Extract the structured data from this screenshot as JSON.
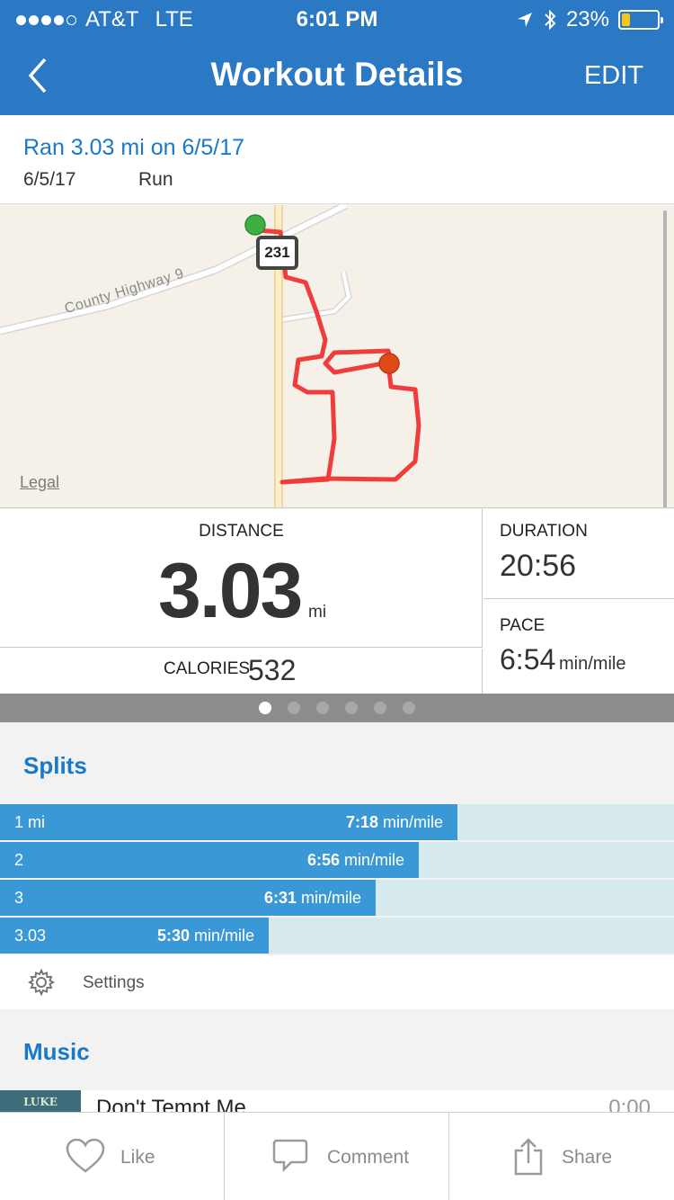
{
  "status": {
    "carrier": "AT&T",
    "network": "LTE",
    "time": "6:01 PM",
    "battery": "23%",
    "battery_level": 0.23,
    "signal_bars": 4
  },
  "nav": {
    "title": "Workout Details",
    "edit_label": "EDIT"
  },
  "workout": {
    "title": "Ran 3.03 mi on 6/5/17",
    "date": "6/5/17",
    "type": "Run"
  },
  "map": {
    "road_label": "County Highway 9",
    "shield_number": "231",
    "legal": "Legal"
  },
  "stats": {
    "distance_label": "DISTANCE",
    "distance_value": "3.03",
    "distance_unit": "mi",
    "calories_label": "CALORIES",
    "calories_value": "532",
    "duration_label": "DURATION",
    "duration_value": "20:56",
    "pace_label": "PACE",
    "pace_value": "6:54",
    "pace_unit": "min/mile"
  },
  "pager": {
    "count": 6,
    "active": 0
  },
  "splits": {
    "title": "Splits",
    "rows": [
      {
        "mile": "1 mi",
        "pace": "7:18",
        "unit": "min/mile",
        "fraction": 0.679
      },
      {
        "mile": "2",
        "pace": "6:56",
        "unit": "min/mile",
        "fraction": 0.621
      },
      {
        "mile": "3",
        "pace": "6:31",
        "unit": "min/mile",
        "fraction": 0.557
      },
      {
        "mile": "3.03",
        "pace": "5:30",
        "unit": "min/mile",
        "fraction": 0.399
      }
    ],
    "settings_label": "Settings"
  },
  "music": {
    "title": "Music",
    "album_art_text": "LUKE COMBS",
    "song": "Don't Tempt Me",
    "duration": "0:00"
  },
  "actions": {
    "like": "Like",
    "comment": "Comment",
    "share": "Share"
  },
  "colors": {
    "brand": "#2b78c5",
    "accent_text": "#1a79c7",
    "split_bar": "#3a98d7",
    "route": "#f03c3c",
    "start_marker": "#3cb043",
    "end_marker": "#e04a1a"
  }
}
